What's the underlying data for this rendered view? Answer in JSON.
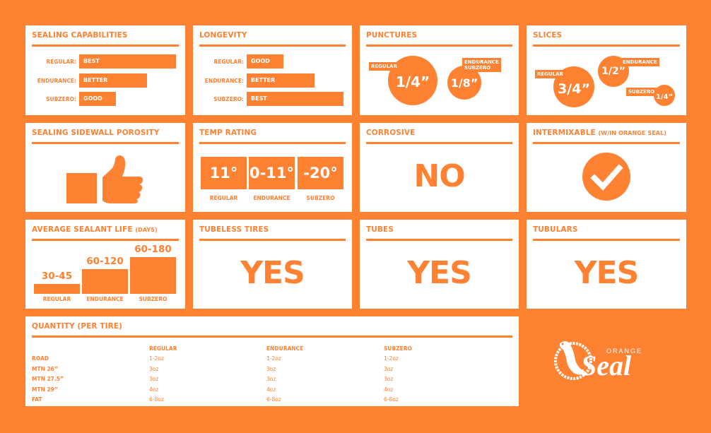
{
  "colors": {
    "brand_orange": "#FF8132",
    "card_bg": "#FFFFFF"
  },
  "sealing": {
    "title": "SEALING CAPABILITIES",
    "rows": [
      {
        "label": "REGULAR:",
        "value": "BEST",
        "level": 3
      },
      {
        "label": "ENDURANCE:",
        "value": "BETTER",
        "level": 2
      },
      {
        "label": "SUBZERO:",
        "value": "GOOD",
        "level": 1
      }
    ]
  },
  "longevity": {
    "title": "LONGEVITY",
    "rows": [
      {
        "label": "REGULAR:",
        "value": "GOOD",
        "level": 1
      },
      {
        "label": "ENDURANCE:",
        "value": "BETTER",
        "level": 2
      },
      {
        "label": "SUBZERO:",
        "value": "BEST",
        "level": 3
      }
    ]
  },
  "punctures": {
    "title": "PUNCTURES",
    "regular": {
      "label": "REGULAR",
      "value": "1/4”"
    },
    "other": {
      "label_1": "ENDURANCE",
      "label_2": "SUBZERO",
      "value": "1/8”"
    }
  },
  "slices": {
    "title": "SLICES",
    "regular": {
      "label": "REGULAR",
      "value": "3/4”"
    },
    "endurance": {
      "label": "ENDURANCE",
      "value": "1/2”"
    },
    "subzero": {
      "label": "SUBZERO",
      "value": "1/4”"
    }
  },
  "porosity": {
    "title": "SEALING SIDEWALL POROSITY",
    "icon": "thumbs-up-icon"
  },
  "temp": {
    "title": "TEMP RATING",
    "items": [
      {
        "value": "11°",
        "label": "REGULAR"
      },
      {
        "value": "0-11°",
        "label": "ENDURANCE"
      },
      {
        "value": "-20°",
        "label": "SUBZERO"
      }
    ]
  },
  "corrosive": {
    "title": "CORROSIVE",
    "value": "NO"
  },
  "intermixable": {
    "title": "INTERMIXABLE",
    "subtitle": "(W/IN ORANGE SEAL)",
    "icon": "check-circle-icon"
  },
  "life": {
    "title": "AVERAGE SEALANT LIFE",
    "subtitle": "(DAYS)",
    "items": [
      {
        "value": "30-45",
        "label": "REGULAR",
        "max_days": 45
      },
      {
        "value": "60-120",
        "label": "ENDURANCE",
        "max_days": 120
      },
      {
        "value": "60-180",
        "label": "SUBZERO",
        "max_days": 180
      }
    ]
  },
  "tubeless": {
    "title": "TUBELESS TIRES",
    "value": "YES"
  },
  "tubes": {
    "title": "TUBES",
    "value": "YES"
  },
  "tubulars": {
    "title": "TUBULARS",
    "value": "YES"
  },
  "quantity": {
    "title": "QUANTITY (PER TIRE)",
    "headers": [
      "",
      "REGULAR",
      "ENDURANCE",
      "SUBZERO"
    ],
    "rows": [
      [
        "ROAD",
        "1-2oz",
        "1-2oz",
        "1-2oz"
      ],
      [
        "MTN 26”",
        "3oz",
        "3oz",
        "3oz"
      ],
      [
        "MTN 27.5”",
        "3oz",
        "3oz",
        "3oz"
      ],
      [
        "MTN 29”",
        "4oz",
        "4oz",
        "4oz"
      ],
      [
        "FAT",
        "6-8oz",
        "6-8oz",
        "6-8oz"
      ]
    ]
  },
  "logo": {
    "small": "ORANGE",
    "big": "Seal"
  }
}
